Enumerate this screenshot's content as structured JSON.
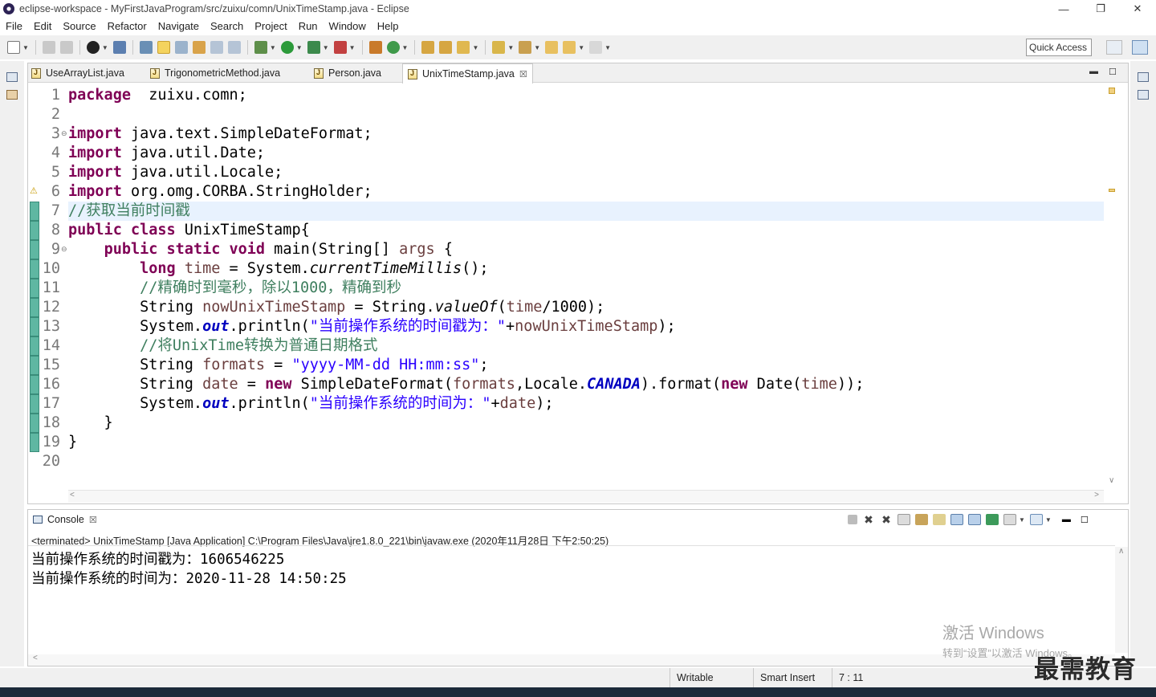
{
  "window": {
    "title": "eclipse-workspace - MyFirstJavaProgram/src/zuixu/comn/UnixTimeStamp.java - Eclipse",
    "minimize": "—",
    "maximize": "❐",
    "close": "✕"
  },
  "menu": [
    "File",
    "Edit",
    "Source",
    "Refactor",
    "Navigate",
    "Search",
    "Project",
    "Run",
    "Window",
    "Help"
  ],
  "quick_access": "Quick Access",
  "editor_tabs": [
    {
      "label": "UseArrayList.java",
      "active": false
    },
    {
      "label": "TrigonometricMethod.java",
      "active": false
    },
    {
      "label": "Person.java",
      "active": false
    },
    {
      "label": "UnixTimeStamp.java",
      "active": true
    }
  ],
  "tab_close": "☒",
  "code_lines": [
    {
      "n": "1",
      "fold": "",
      "t": [
        [
          "kw",
          "package"
        ],
        [
          "",
          "  zuixu.comn;"
        ]
      ]
    },
    {
      "n": "2",
      "fold": "",
      "t": []
    },
    {
      "n": "3",
      "fold": "⊖",
      "t": [
        [
          "kw",
          "import"
        ],
        [
          "",
          " java.text.SimpleDateFormat;"
        ]
      ]
    },
    {
      "n": "4",
      "fold": "",
      "t": [
        [
          "kw",
          "import"
        ],
        [
          "",
          " java.util.Date;"
        ]
      ]
    },
    {
      "n": "5",
      "fold": "",
      "t": [
        [
          "kw",
          "import"
        ],
        [
          "",
          " java.util.Locale;"
        ]
      ]
    },
    {
      "n": "6",
      "fold": "",
      "t": [
        [
          "kw",
          "import"
        ],
        [
          "",
          " org.omg.CORBA.StringHolder;"
        ]
      ]
    },
    {
      "n": "7",
      "fold": "",
      "cur": true,
      "t": [
        [
          "cmt",
          "//获取当前时间戳"
        ]
      ]
    },
    {
      "n": "8",
      "fold": "",
      "t": [
        [
          "kw",
          "public class"
        ],
        [
          "",
          " UnixTimeStamp{"
        ]
      ]
    },
    {
      "n": "9",
      "fold": "⊖",
      "t": [
        [
          "",
          "    "
        ],
        [
          "kw",
          "public static void"
        ],
        [
          "",
          " main(String[] "
        ],
        [
          "var",
          "args"
        ],
        [
          "",
          " {"
        ]
      ]
    },
    {
      "n": "10",
      "fold": "",
      "t": [
        [
          "",
          "        "
        ],
        [
          "kw",
          "long"
        ],
        [
          "",
          " "
        ],
        [
          "var",
          "time"
        ],
        [
          "",
          " = System."
        ],
        [
          "sm",
          "currentTimeMillis"
        ],
        [
          "",
          "();"
        ]
      ]
    },
    {
      "n": "11",
      "fold": "",
      "t": [
        [
          "",
          "        "
        ],
        [
          "cmt",
          "//精确时到毫秒，除以1000，精确到秒"
        ]
      ]
    },
    {
      "n": "12",
      "fold": "",
      "t": [
        [
          "",
          "        String "
        ],
        [
          "var",
          "nowUnixTimeStamp"
        ],
        [
          "",
          " = String."
        ],
        [
          "sm",
          "valueOf"
        ],
        [
          "",
          "("
        ],
        [
          "var",
          "time"
        ],
        [
          "",
          "/1000);"
        ]
      ]
    },
    {
      "n": "13",
      "fold": "",
      "t": [
        [
          "",
          "        System."
        ],
        [
          "fld",
          "out"
        ],
        [
          "",
          ".println("
        ],
        [
          "str",
          "\"当前操作系统的时间戳为：\""
        ],
        [
          "",
          "+"
        ],
        [
          "var",
          "nowUnixTimeStamp"
        ],
        [
          "",
          ");"
        ]
      ]
    },
    {
      "n": "14",
      "fold": "",
      "t": [
        [
          "",
          "        "
        ],
        [
          "cmt",
          "//将UnixTime转换为普通日期格式"
        ]
      ]
    },
    {
      "n": "15",
      "fold": "",
      "t": [
        [
          "",
          "        String "
        ],
        [
          "var",
          "formats"
        ],
        [
          "",
          " = "
        ],
        [
          "str",
          "\"yyyy-MM-dd HH:mm:ss\""
        ],
        [
          "",
          ";"
        ]
      ]
    },
    {
      "n": "16",
      "fold": "",
      "t": [
        [
          "",
          "        String "
        ],
        [
          "var",
          "date"
        ],
        [
          "",
          " = "
        ],
        [
          "kw",
          "new"
        ],
        [
          "",
          " SimpleDateFormat("
        ],
        [
          "var",
          "formats"
        ],
        [
          "",
          ",Locale."
        ],
        [
          "fld",
          "CANADA"
        ],
        [
          "",
          ").format("
        ],
        [
          "kw",
          "new"
        ],
        [
          "",
          " Date("
        ],
        [
          "var",
          "time"
        ],
        [
          "",
          "));"
        ]
      ]
    },
    {
      "n": "17",
      "fold": "",
      "t": [
        [
          "",
          "        System."
        ],
        [
          "fld",
          "out"
        ],
        [
          "",
          ".println("
        ],
        [
          "str",
          "\"当前操作系统的时间为：\""
        ],
        [
          "",
          "+"
        ],
        [
          "var",
          "date"
        ],
        [
          "",
          ");"
        ]
      ]
    },
    {
      "n": "18",
      "fold": "",
      "t": [
        [
          "",
          "    }"
        ]
      ]
    },
    {
      "n": "19",
      "fold": "",
      "t": [
        [
          "",
          "}"
        ]
      ]
    },
    {
      "n": "20",
      "fold": "",
      "t": []
    }
  ],
  "console": {
    "tab_label": "Console",
    "status": "<terminated> UnixTimeStamp [Java Application] C:\\Program Files\\Java\\jre1.8.0_221\\bin\\javaw.exe (2020年11月28日 下午2:50:25)",
    "output": [
      "当前操作系统的时间戳为：1606546225",
      "当前操作系统的时间为：2020-11-28 14:50:25"
    ]
  },
  "status": {
    "writable": "Writable",
    "insert_mode": "Smart Insert",
    "position": "7 : 11"
  },
  "watermark": {
    "line1": "激活 Windows",
    "line2": "转到“设置”以激活 Windows。"
  },
  "brand": "最需教育",
  "colors": {
    "keyword": "#7f0055",
    "string": "#2a00ff",
    "comment": "#3f7f5f",
    "field": "#0000c0",
    "variable": "#6a3e3e"
  }
}
